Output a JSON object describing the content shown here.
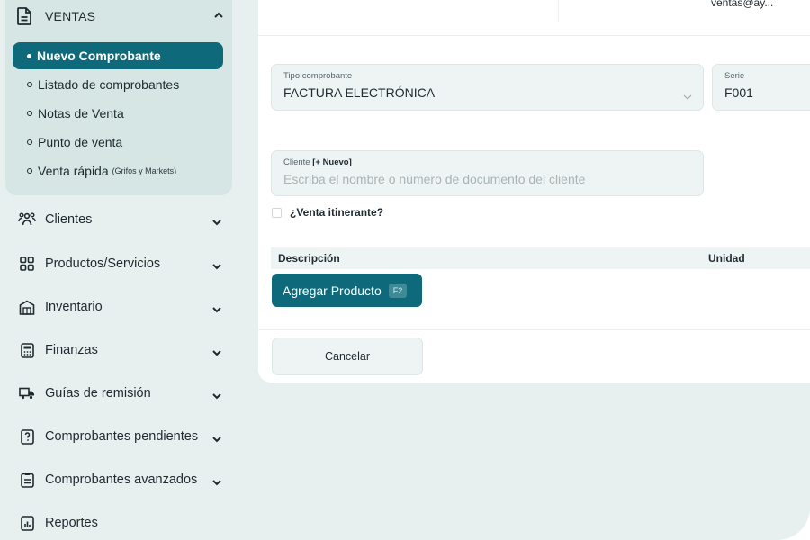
{
  "header": {
    "user_email": "ventas@ay..."
  },
  "sidebar": {
    "ventas": {
      "label": "VENTAS",
      "icon": "document-icon",
      "items": [
        {
          "label": "Nuevo Comprobante",
          "active": true
        },
        {
          "label": "Listado de comprobantes"
        },
        {
          "label": "Notas de Venta"
        },
        {
          "label": "Punto de venta"
        },
        {
          "label": "Venta rápida",
          "note": "(Grifos y Markets)"
        }
      ]
    },
    "items": [
      {
        "label": "Clientes",
        "icon": "users-icon"
      },
      {
        "label": "Productos/Servicios",
        "icon": "grid-icon"
      },
      {
        "label": "Inventario",
        "icon": "warehouse-icon"
      },
      {
        "label": "Finanzas",
        "icon": "calculator-icon"
      },
      {
        "label": "Guías de remisión",
        "icon": "truck-icon"
      },
      {
        "label": "Comprobantes pendientes",
        "icon": "pending-doc-icon"
      },
      {
        "label": "Comprobantes avanzados",
        "icon": "clipboard-icon"
      },
      {
        "label": "Reportes",
        "icon": "report-icon"
      }
    ]
  },
  "form": {
    "tipo_comprobante": {
      "label": "Tipo comprobante",
      "value": "FACTURA ELECTRÓNICA"
    },
    "serie": {
      "label": "Serie",
      "value": "F001"
    },
    "cliente": {
      "label": "Cliente",
      "new_link": "[+ Nuevo]",
      "placeholder": "Escriba el nombre o número de documento del cliente"
    },
    "venta_itinerante": {
      "label": "¿Venta itinerante?",
      "checked": false
    }
  },
  "table": {
    "columns": [
      "Descripción",
      "Unidad"
    ]
  },
  "buttons": {
    "add_product": "Agregar Producto",
    "add_product_shortcut": "F2",
    "cancel": "Cancelar"
  },
  "colors": {
    "accent": "#0e6a7a",
    "sidebar_bg": "#e7f0ef"
  }
}
